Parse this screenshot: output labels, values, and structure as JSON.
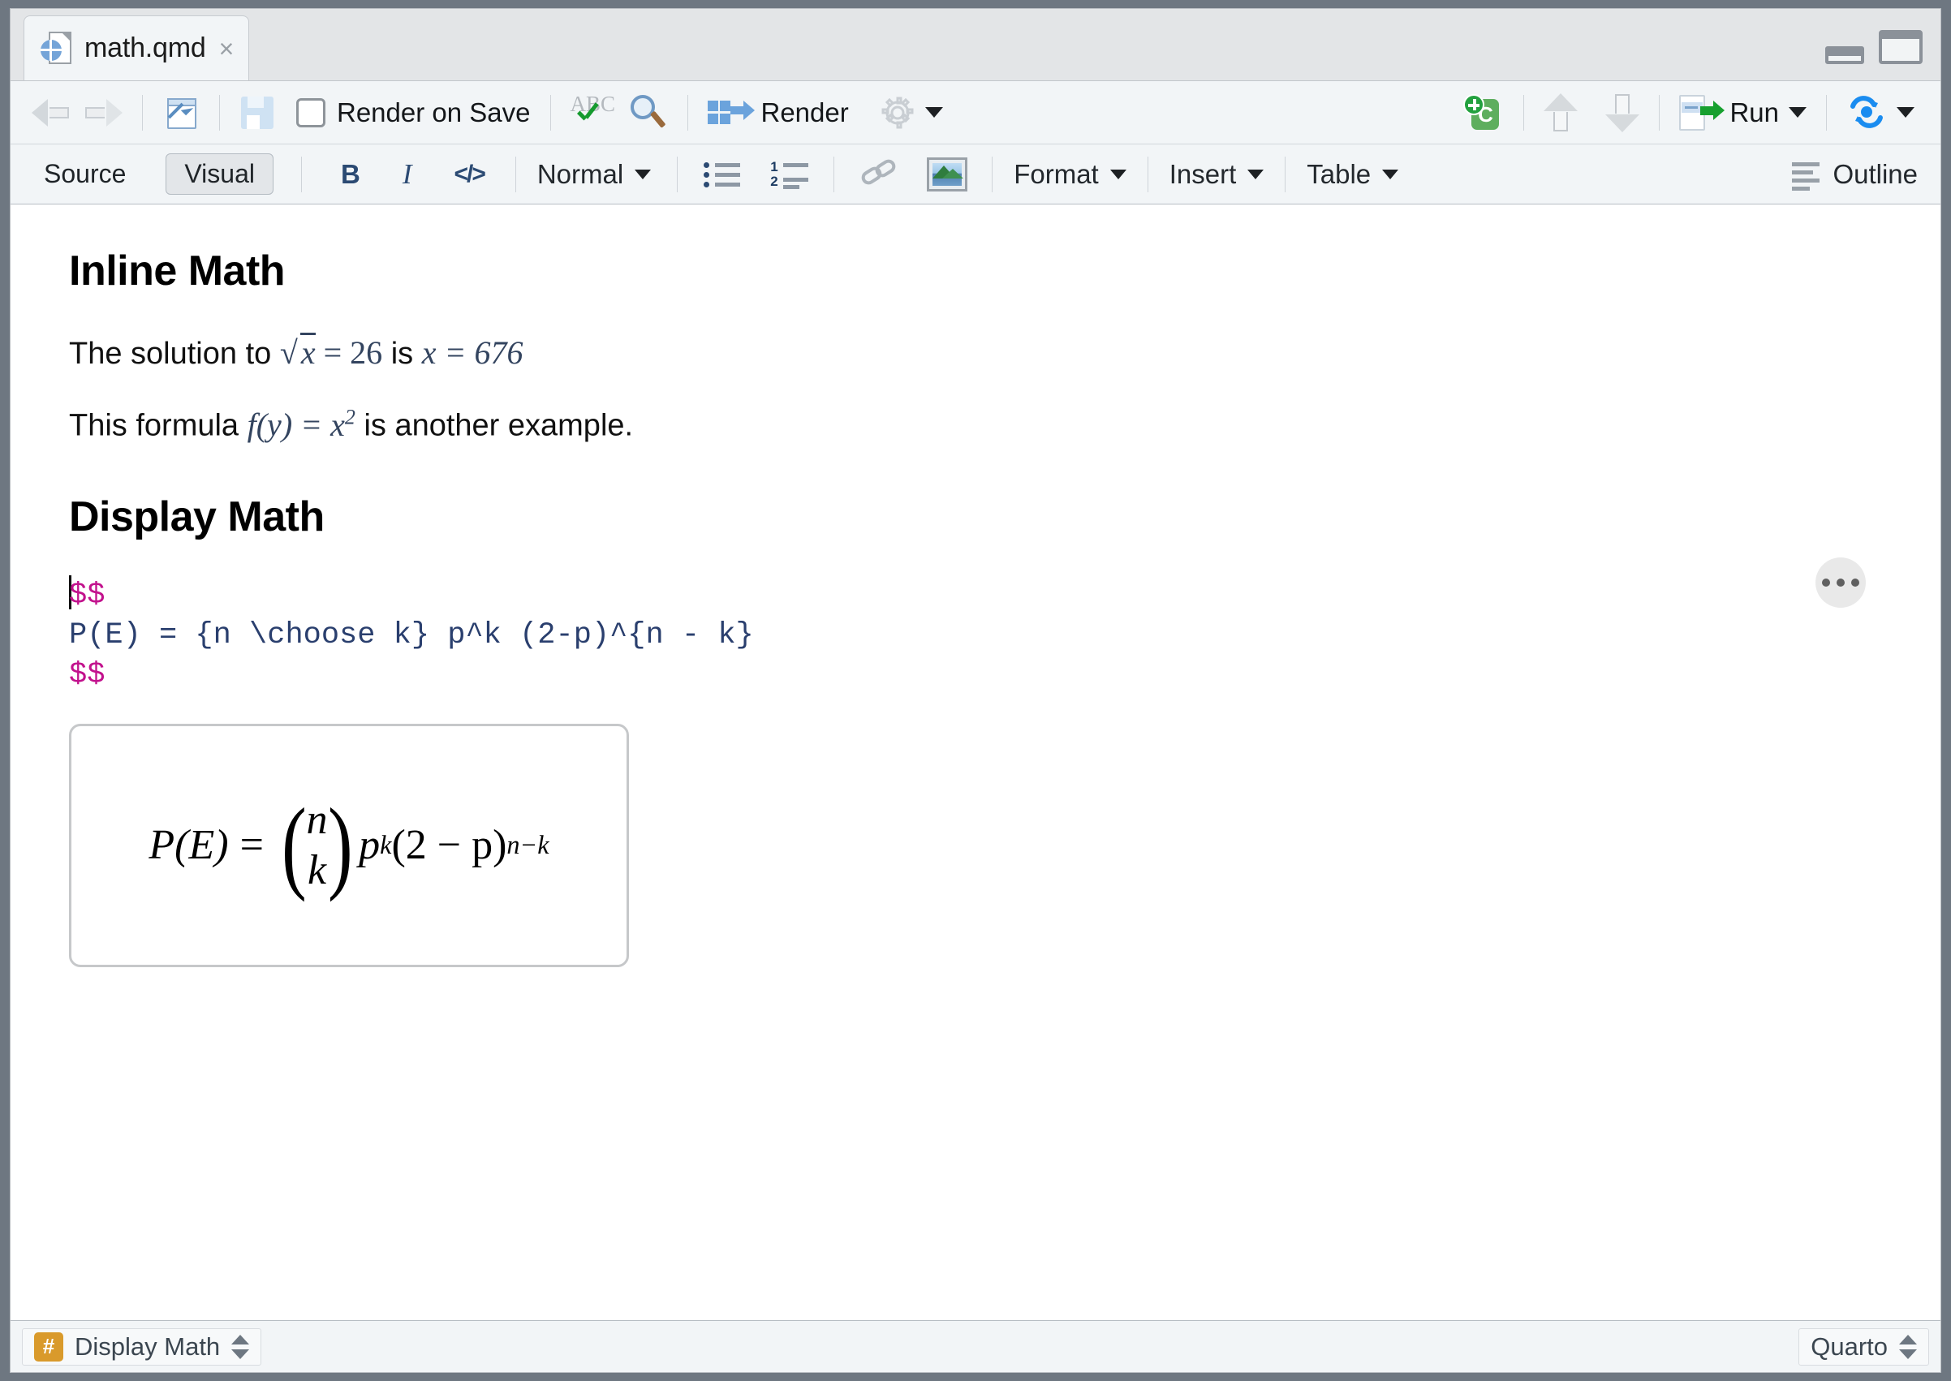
{
  "window": {
    "tab": {
      "filename": "math.qmd",
      "close_label": "×",
      "icon": "quarto-doc-icon"
    },
    "pane_buttons": {
      "minimize": "minimize-pane",
      "maximize": "maximize-pane"
    }
  },
  "main_toolbar": {
    "back_icon": "back-arrow-icon",
    "forward_icon": "forward-arrow-icon",
    "popout_icon": "show-in-new-window-icon",
    "save_icon": "save-icon",
    "render_on_save_label": "Render on Save",
    "render_on_save_checked": false,
    "spellcheck_icon": "spellcheck-icon",
    "spellcheck_text": "ABC",
    "find_icon": "find-replace-icon",
    "render_label": "Render",
    "render_icon": "render-icon",
    "gear_icon": "settings-gear-icon",
    "gear_caret": "chevron-down-icon",
    "insert_chunk_icon": "insert-chunk-icon",
    "insert_chunk_letter": "C",
    "prev_chunk_icon": "previous-chunk-icon",
    "next_chunk_icon": "next-chunk-icon",
    "run_label": "Run",
    "run_icon": "run-chunk-icon",
    "rerun_icon": "rerun-icon"
  },
  "visual_toolbar": {
    "source_label": "Source",
    "visual_label": "Visual",
    "active_mode": "Visual",
    "bold_label": "B",
    "italic_label": "I",
    "code_label": "</>",
    "block_format_label": "Normal",
    "bullet_list_icon": "bullet-list-icon",
    "numbered_list_icon": "numbered-list-icon",
    "numbered_list_one": "1",
    "numbered_list_two": "2",
    "link_icon": "link-icon",
    "image_icon": "insert-image-icon",
    "format_label": "Format",
    "insert_label": "Insert",
    "table_label": "Table",
    "outline_label": "Outline"
  },
  "document": {
    "heading_1": "Inline Math",
    "paragraph_1": {
      "prefix": "The solution to ",
      "math_1_sqrt_symbol": "√",
      "math_1_radicand": "x",
      "math_1_rest": " = 26",
      "middle": " is ",
      "math_2": "x = 676"
    },
    "paragraph_2": {
      "prefix": "This formula ",
      "math_fn": "f(y) = x",
      "math_exp": "2",
      "suffix": " is another example."
    },
    "heading_2": "Display Math",
    "code_block": {
      "open_delim": "$$",
      "latex": "P(E) = {n \\choose k} p^k (2-p)^{n - k}",
      "close_delim": "$$",
      "menu_icon": "more-options-icon"
    },
    "formula_preview": {
      "lhs": "P(E)",
      "equals": "=",
      "binom_top": "n",
      "binom_bottom": "k",
      "p_base": "p",
      "p_exp": "k",
      "paren_expr": "(2 − p)",
      "paren_exp": "n−k"
    }
  },
  "status_bar": {
    "section_badge": "#",
    "section_label": "Display Math",
    "format_label": "Quarto"
  },
  "colors": {
    "math_inline": "#33445f",
    "code_text": "#2a3f6e",
    "dollar_delim": "#c2128d",
    "accent_blue": "#2b4a73",
    "badge_orange": "#d99a2b",
    "run_green": "#17a02f"
  }
}
